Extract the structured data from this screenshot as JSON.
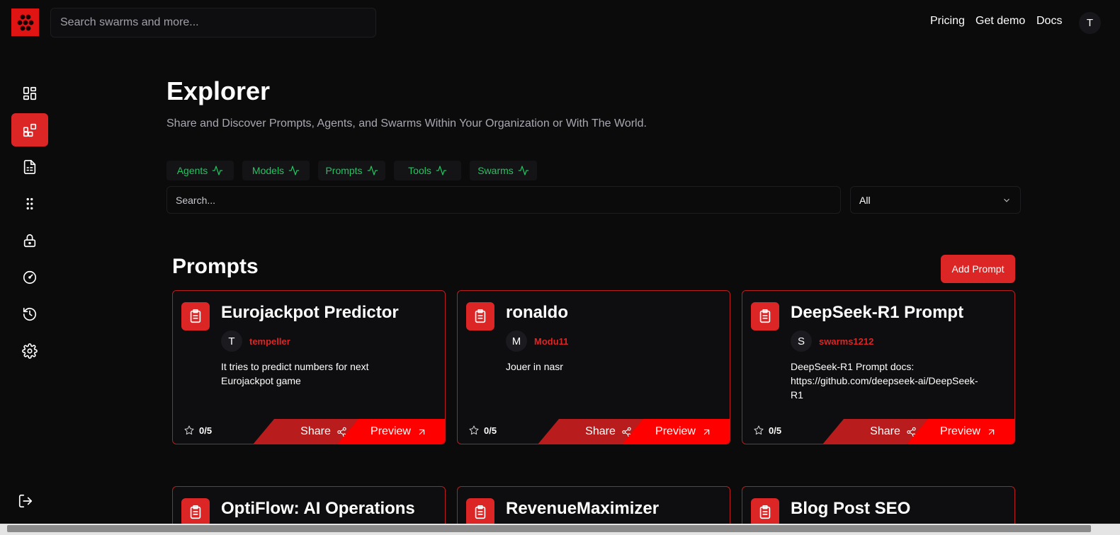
{
  "header": {
    "search_placeholder": "Search swarms and more...",
    "nav": [
      "Pricing",
      "Get demo",
      "Docs"
    ],
    "user_initial": "T"
  },
  "sidebar": {
    "items": [
      {
        "icon": "dashboard-icon",
        "active": false
      },
      {
        "icon": "explorer-icon",
        "active": true
      },
      {
        "icon": "document-icon",
        "active": false
      },
      {
        "icon": "dots-grid-icon",
        "active": false
      },
      {
        "icon": "lock-icon",
        "active": false
      },
      {
        "icon": "gauge-icon",
        "active": false
      },
      {
        "icon": "history-icon",
        "active": false
      },
      {
        "icon": "gear-icon",
        "active": false
      }
    ],
    "logout_icon": "logout-icon"
  },
  "page": {
    "title": "Explorer",
    "subtitle": "Share and Discover Prompts, Agents, and Swarms Within Your Organization or With The World."
  },
  "filters": {
    "tabs": [
      "Agents",
      "Models",
      "Prompts",
      "Tools",
      "Swarms"
    ],
    "search_placeholder": "Search...",
    "select_value": "All"
  },
  "section": {
    "title": "Prompts",
    "add_label": "Add Prompt"
  },
  "cards": [
    {
      "title": "Eurojackpot Predictor",
      "author_initial": "T",
      "author": "tempeller",
      "description": "It tries to predict numbers for next Eurojackpot game",
      "rating": "0/5",
      "share": "Share",
      "preview": "Preview"
    },
    {
      "title": "ronaldo",
      "author_initial": "M",
      "author": "Modu11",
      "description": "Jouer in nasr",
      "rating": "0/5",
      "share": "Share",
      "preview": "Preview"
    },
    {
      "title": "DeepSeek-R1 Prompt",
      "author_initial": "S",
      "author": "swarms1212",
      "description": "DeepSeek-R1 Prompt docs: https://github.com/deepseek-ai/DeepSeek-R1",
      "rating": "0/5",
      "share": "Share",
      "preview": "Preview"
    },
    {
      "title": "OptiFlow: AI Operations"
    },
    {
      "title": "RevenueMaximizer"
    },
    {
      "title": "Blog Post SEO"
    }
  ],
  "colors": {
    "accent": "#dc2626",
    "preview": "#ff0000",
    "tab_text": "#22c55e",
    "background": "#0b0b0c"
  }
}
